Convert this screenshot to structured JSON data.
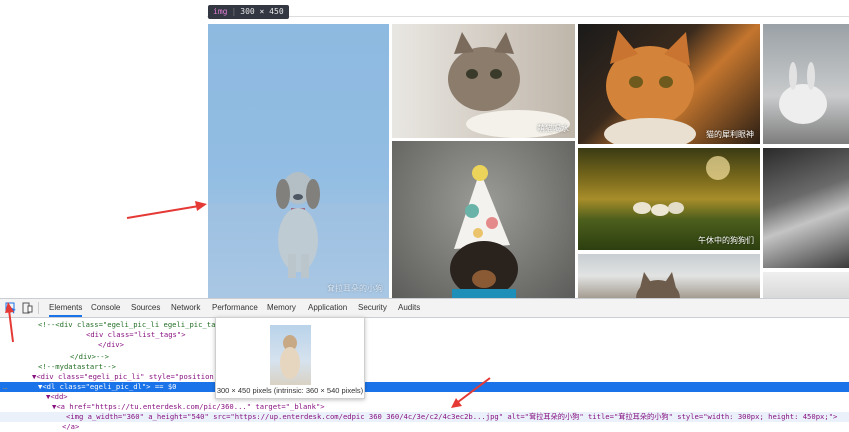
{
  "inspector_tooltip": {
    "tag": "img",
    "size": "300 × 450"
  },
  "photos": [
    {
      "id": "dog",
      "caption": "耷拉耳朵的小狗"
    },
    {
      "id": "cat-drinking",
      "caption": "萌猫喝水"
    },
    {
      "id": "orange-cat",
      "caption": "猫的犀利眼神"
    },
    {
      "id": "ducks",
      "caption": "午休中的狗狗们"
    }
  ],
  "devtools": {
    "tabs": [
      "Elements",
      "Console",
      "Sources",
      "Network",
      "Performance",
      "Memory",
      "Application",
      "Security",
      "Audits"
    ],
    "active_tab": "Elements",
    "dom_lines": [
      {
        "indent": 2,
        "html": "<!--<div class=\"egeli_pic_li egeli_pic_tag\">"
      },
      {
        "indent": 8,
        "html": "<div class=\"list_tags\">"
      },
      {
        "indent": 10,
        "html": "</div>"
      },
      {
        "indent": 6,
        "html": "</div>-->"
      },
      {
        "indent": 2,
        "html": "<!--mydatastart-->"
      },
      {
        "indent": 2,
        "html": "▼<div class=\"egeli_pic_li\" style=\"position: ab"
      },
      {
        "indent": 4,
        "html": "▼<dl class=\"egeli_pic_dl\"> == $0"
      },
      {
        "indent": 6,
        "html": "▼<dd>"
      },
      {
        "indent": 8,
        "html": "▼<a href=\"https://tu.enterdesk.com/pic/360...\" target=\"_blank\">"
      },
      {
        "indent": 10,
        "html": "<img a_width=\"360\" a_height=\"540\" src=\"https://up.enterdesk.com/edpic 360 360/4c/3e/c2/4c3ec2b...jpg\" alt=\"耷拉耳朵的小狗\" title=\"耷拉耳朵的小狗\" style=\"width: 300px; height: 450px;\">"
      },
      {
        "indent": 10,
        "html": "</a>"
      },
      {
        "indent": 8,
        "html": "</dd>"
      }
    ],
    "image_preview": {
      "text": "300 × 450 pixels (intrinsic: 360 × 540 pixels)"
    }
  },
  "colors": {
    "accent": "#1a73e8",
    "highlight": "#6fa8dc",
    "arrow": "#e53935"
  }
}
